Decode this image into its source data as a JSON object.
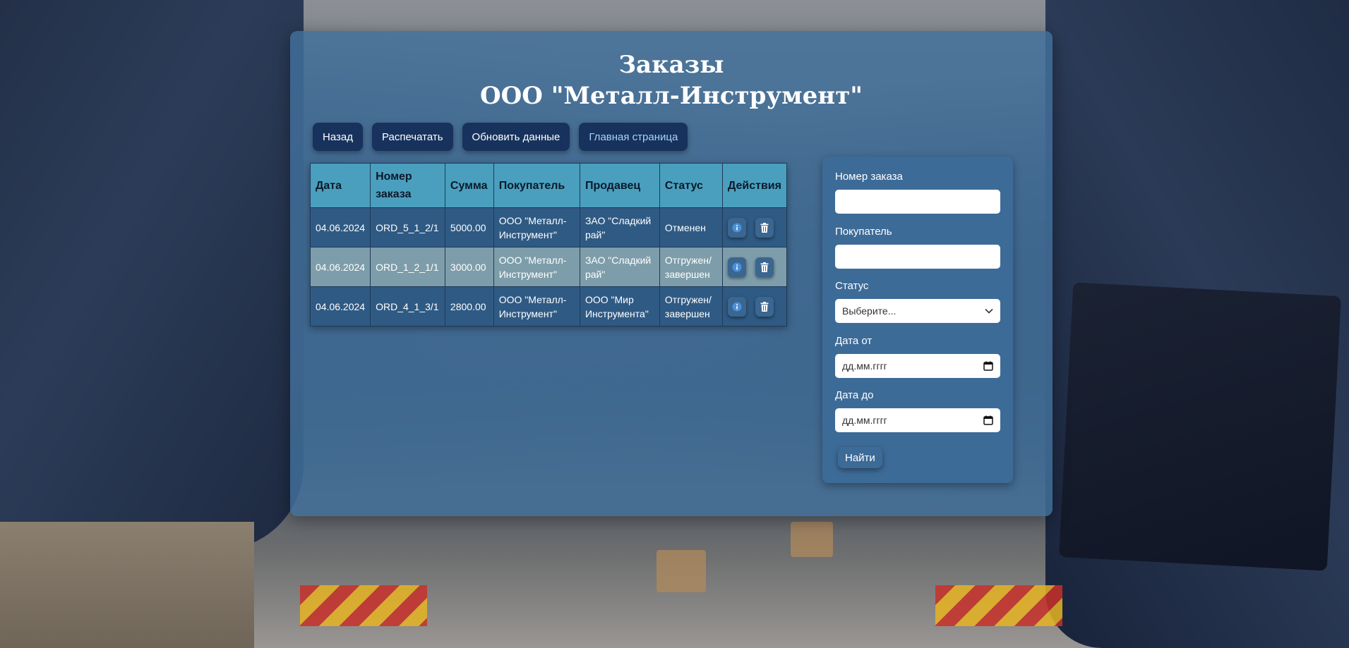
{
  "page": {
    "title_line1": "Заказы",
    "title_line2": "ООО \"Металл-Инструмент\""
  },
  "toolbar": {
    "back": "Назад",
    "print": "Распечатать",
    "refresh": "Обновить данные",
    "home": "Главная страница"
  },
  "table": {
    "headers": [
      "Дата",
      "Номер заказа",
      "Сумма",
      "Покупатель",
      "Продавец",
      "Статус",
      "Действия"
    ],
    "rows": [
      {
        "date": "04.06.2024",
        "number": "ORD_5_1_2/1",
        "sum": "5000.00",
        "buyer": "ООО \"Металл-Инструмент\"",
        "seller": "ЗАО \"Сладкий рай\"",
        "status": "Отменен"
      },
      {
        "date": "04.06.2024",
        "number": "ORD_1_2_1/1",
        "sum": "3000.00",
        "buyer": "ООО \"Металл-Инструмент\"",
        "seller": "ЗАО \"Сладкий рай\"",
        "status": "Отгружен/ завершен"
      },
      {
        "date": "04.06.2024",
        "number": "ORD_4_1_3/1",
        "sum": "2800.00",
        "buyer": "ООО \"Металл-Инструмент\"",
        "seller": "ООО \"Мир Инструмента\"",
        "status": "Отгружен/ завершен"
      }
    ]
  },
  "filter": {
    "order_number_label": "Номер заказа",
    "order_number_value": "",
    "buyer_label": "Покупатель",
    "buyer_value": "",
    "status_label": "Статус",
    "status_selected": "Выберите...",
    "date_from_label": "Дата от",
    "date_from_placeholder": "дд.мм.гггг",
    "date_to_label": "Дата до",
    "date_to_placeholder": "дд.мм.гггг",
    "find_button": "Найти"
  },
  "colors": {
    "panel": "#42709b",
    "button": "#17325c",
    "table_header": "#4a9fbe",
    "row_dark": "#2e5a84",
    "row_light": "#82a0ac",
    "info_icon": "#4a90d9",
    "home_link": "#a6d3ff"
  },
  "icons": {
    "info": "info-circle-icon",
    "delete": "trash-icon",
    "select": "chevron-down-icon",
    "calendar": "calendar-icon"
  }
}
